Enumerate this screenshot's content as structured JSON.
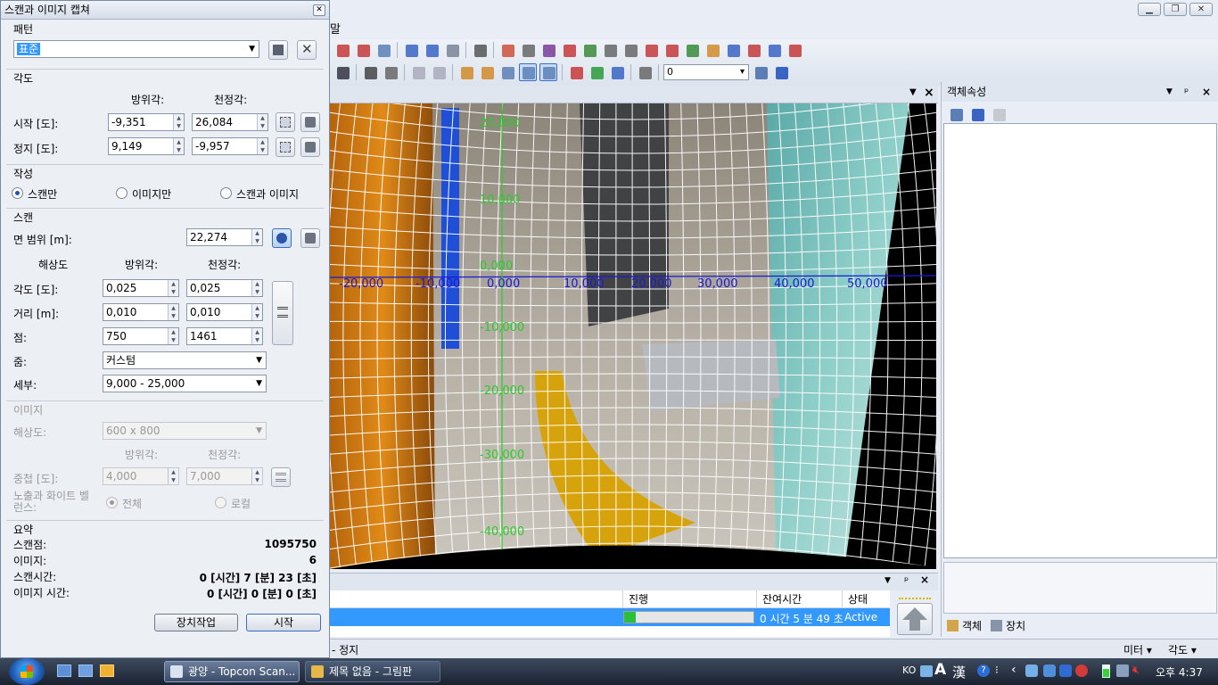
{
  "main_window": {
    "menu_stub": "말"
  },
  "dialog": {
    "title": "스캔과 이미지 캡쳐",
    "pattern": {
      "heading": "패턴",
      "selected": "표준"
    },
    "angle": {
      "heading": "각도",
      "col_azimuth": "방위각:",
      "col_zenith": "천정각:",
      "start_label": "시작 [도]:",
      "start_azimuth": "-9,351",
      "start_zenith": "26,084",
      "stop_label": "정지 [도]:",
      "stop_azimuth": "9,149",
      "stop_zenith": "-9,957"
    },
    "create": {
      "heading": "작성",
      "options": [
        "스캔만",
        "이미지만",
        "스캔과 이미지"
      ],
      "selected": "스캔만"
    },
    "scan": {
      "heading": "스캔",
      "range_label": "면 범위 [m]:",
      "range_value": "22,274",
      "col_resolution": "해상도",
      "col_azimuth": "방위각:",
      "col_zenith": "천정각:",
      "angle_label": "각도 [도]:",
      "angle_az": "0,025",
      "angle_ze": "0,025",
      "distance_label": "거리 [m]:",
      "distance_az": "0,010",
      "distance_ze": "0,010",
      "points_label": "점:",
      "points_az": "750",
      "points_ze": "1461",
      "zoom_label": "줌:",
      "zoom_value": "커스텀",
      "detail_label": "세부:",
      "detail_value": "9,000 - 25,000"
    },
    "image": {
      "heading": "이미지",
      "resolution_label": "해상도:",
      "resolution_value": "600 x 800",
      "col_azimuth": "방위각:",
      "col_zenith": "천정각:",
      "overlap_label": "중첩 [도]:",
      "overlap_az": "4,000",
      "overlap_ze": "7,000",
      "exposure_label_1": "노출과 화이트 벨",
      "exposure_label_2": "런스:",
      "exposure_all": "전체",
      "exposure_local": "로컬"
    },
    "summary": {
      "heading": "요약",
      "scan_points_label": "스캔점:",
      "scan_points_value": "1095750",
      "images_label": "이미지:",
      "images_value": "6",
      "scan_time_label": "스캔시간:",
      "scan_time_value": "0 [시간] 7 [분] 23 [초]",
      "image_time_label": "이미지 시간:",
      "image_time_value": "0 [시간] 0 [분] 0 [초]"
    },
    "buttons": {
      "device_task": "장치작업",
      "start": "시작"
    }
  },
  "viewer": {
    "h_ticks": [
      "-20,000",
      "-10,000",
      "0,000",
      "10,000",
      "20,000",
      "30,000",
      "40,000",
      "50,000"
    ],
    "v_ticks": [
      "20,000",
      "10,000",
      "0,000",
      "-10,000",
      "-20,000",
      "-30,000",
      "-40,000"
    ]
  },
  "properties": {
    "title": "객체속성",
    "tab_objects": "객체",
    "tab_devices": "장치"
  },
  "progress": {
    "col_progress": "진행",
    "col_remaining": "잔여시간",
    "col_status": "상태",
    "remaining": "0 시간 5 분 49 초",
    "status": "Active",
    "fraction": 0.09
  },
  "layer_combo": "0",
  "statusbar": {
    "left_text": "- 정지",
    "units": "미터",
    "angle": "각도"
  },
  "taskbar": {
    "task1": "광양 - Topcon Scan...",
    "task2": "제목 없음 - 그림판",
    "lang": "KO",
    "ime_a": "A",
    "ime_han": "漢",
    "clock": "오후 4:37"
  },
  "colors": {
    "selection": "#3399ff",
    "progress_fill": "#2bbf3a",
    "axis_blue": "#1a1ad6",
    "axis_green": "#2dc92d"
  }
}
